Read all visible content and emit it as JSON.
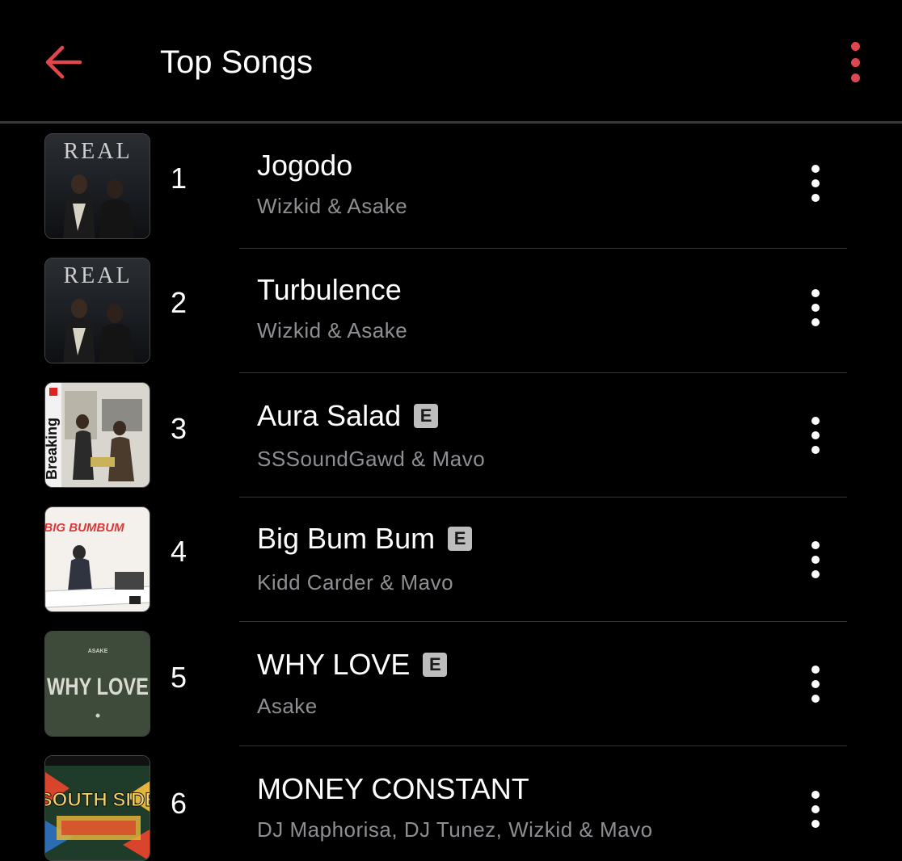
{
  "header": {
    "title": "Top Songs",
    "back_icon": "arrow-left-icon",
    "more_icon": "more-vertical-icon",
    "accent_color": "#e0474c"
  },
  "songs": [
    {
      "rank": "1",
      "title": "Jogodo",
      "artist": "Wizkid & Asake",
      "explicit": false,
      "art_text": "REAL",
      "art": "real-cover"
    },
    {
      "rank": "2",
      "title": "Turbulence",
      "artist": "Wizkid & Asake",
      "explicit": false,
      "art_text": "REAL",
      "art": "real-cover"
    },
    {
      "rank": "3",
      "title": "Aura Salad",
      "artist": "SSSoundGawd & Mavo",
      "explicit": true,
      "explicit_label": "E",
      "art_text": "Breaking",
      "art": "breaking-cover"
    },
    {
      "rank": "4",
      "title": "Big Bum Bum",
      "artist": "Kidd Carder & Mavo",
      "explicit": true,
      "explicit_label": "E",
      "art_text": "BIG BUMBUM",
      "art": "bigbumbum-cover"
    },
    {
      "rank": "5",
      "title": "WHY LOVE",
      "artist": "Asake",
      "explicit": true,
      "explicit_label": "E",
      "art_text": "WHY LOVE",
      "art_top": "ASAKE",
      "art": "whylove-cover"
    },
    {
      "rank": "6",
      "title": "MONEY CONSTANT",
      "artist": "DJ Maphorisa, DJ Tunez, Wizkid & Mavo",
      "explicit": false,
      "art_text": "SOUTH SIDE",
      "art": "southside-cover"
    }
  ]
}
